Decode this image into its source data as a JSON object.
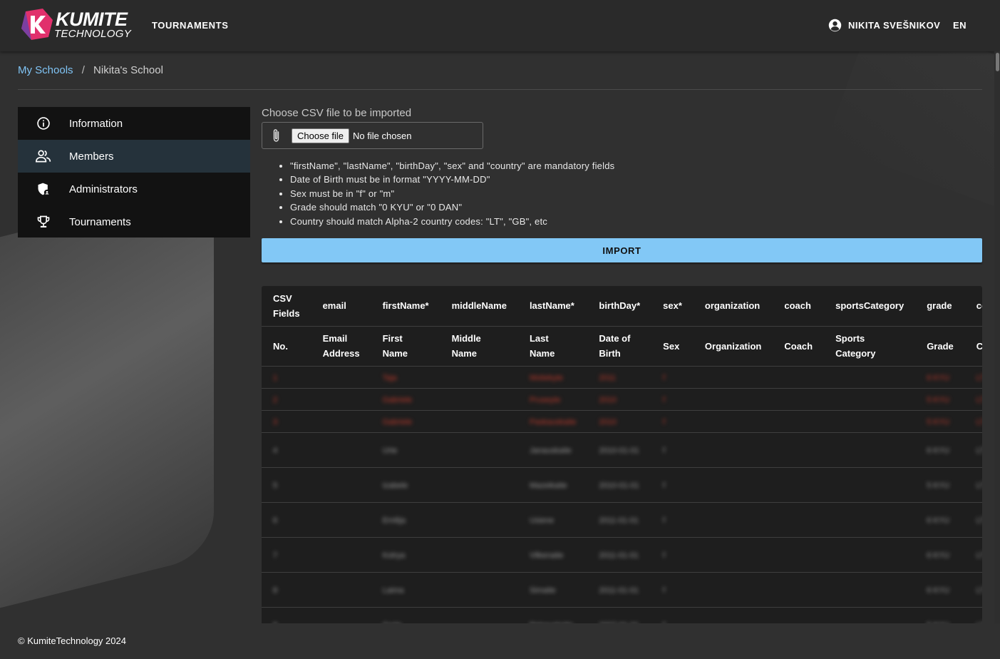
{
  "brand": {
    "line1": "KUMITE",
    "line2": "TECHNOLOGY",
    "colors": {
      "pink": "#e1306c",
      "purple": "#7b3fa0",
      "white": "#ffffff"
    }
  },
  "header": {
    "nav_tournaments": "TOURNAMENTS",
    "user_name": "NIKITA SVEŠNIKOV",
    "language": "EN"
  },
  "breadcrumb": {
    "link": "My Schools",
    "separator": "/",
    "current": "Nikita's School"
  },
  "sidebar": {
    "items": [
      {
        "label": "Information",
        "icon": "info-icon",
        "active": false
      },
      {
        "label": "Members",
        "icon": "people-icon",
        "active": true
      },
      {
        "label": "Administrators",
        "icon": "admin-shield-icon",
        "active": false
      },
      {
        "label": "Tournaments",
        "icon": "trophy-icon",
        "active": false
      }
    ]
  },
  "import": {
    "label": "Choose CSV file to be imported",
    "choose_button": "Choose file",
    "file_status": "No file chosen",
    "rules": [
      "\"firstName\", \"lastName\", \"birthDay\", \"sex\" and \"country\" are mandatory fields",
      "Date of Birth must be in format \"YYYY-MM-DD\"",
      "Sex must be in \"f\" or \"m\"",
      "Grade should match \"0 KYU\" or \"0 DAN\"",
      "Country should match Alpha-2 country codes: \"LT\", \"GB\", etc"
    ],
    "button": "IMPORT",
    "accent_color": "#82c8f6"
  },
  "table": {
    "csv_fields": [
      "CSV Fields",
      "email",
      "firstName*",
      "middleName",
      "lastName*",
      "birthDay*",
      "sex*",
      "organization",
      "coach",
      "sportsCategory",
      "grade",
      "country*"
    ],
    "labels": [
      "No.",
      "Email Address",
      "First Name",
      "Middle Name",
      "Last Name",
      "Date of Birth",
      "Sex",
      "Organization",
      "Coach",
      "Sports Category",
      "Grade",
      "Country"
    ],
    "error_color": "#c0392b",
    "rows": [
      {
        "status": "error",
        "cells": [
          "1",
          "",
          "Taja",
          "",
          "Motiekyte",
          "2011",
          "f",
          "",
          "",
          "",
          "6 KYU",
          "LT"
        ]
      },
      {
        "status": "error",
        "cells": [
          "2",
          "",
          "Gabriele",
          "",
          "Pruseyte",
          "2010",
          "f",
          "",
          "",
          "",
          "5 KYU",
          "LT"
        ]
      },
      {
        "status": "error",
        "cells": [
          "3",
          "",
          "Gabriele",
          "",
          "Paskauskaite",
          "2010",
          "f",
          "",
          "",
          "",
          "5 KYU",
          "LT"
        ]
      },
      {
        "status": "ok",
        "cells": [
          "4",
          "",
          "Urte",
          "",
          "Janauskaite",
          "2010-01-01",
          "f",
          "",
          "",
          "",
          "6 KYU",
          "LT"
        ]
      },
      {
        "status": "ok",
        "cells": [
          "5",
          "",
          "Izabele",
          "",
          "Mazeikaite",
          "2010-01-01",
          "f",
          "",
          "",
          "",
          "5 KYU",
          "LT"
        ]
      },
      {
        "status": "ok",
        "cells": [
          "6",
          "",
          "Emilija",
          "",
          "Usiene",
          "2011-01-01",
          "f",
          "",
          "",
          "",
          "6 KYU",
          "LT"
        ]
      },
      {
        "status": "ok",
        "cells": [
          "7",
          "",
          "Kotrya",
          "",
          "Vilkenaite",
          "2011-01-01",
          "f",
          "",
          "",
          "",
          "6 KYU",
          "LT"
        ]
      },
      {
        "status": "ok",
        "cells": [
          "8",
          "",
          "Laima",
          "",
          "Simaite",
          "2011-01-01",
          "f",
          "",
          "",
          "",
          "6 KYU",
          "LT"
        ]
      },
      {
        "status": "ok",
        "cells": [
          "9",
          "",
          "Goda",
          "",
          "Petrauskaite",
          "2007-01-01",
          "f",
          "",
          "",
          "",
          "5 KYU",
          "LT"
        ]
      }
    ]
  },
  "footer": {
    "text": "© KumiteTechnology 2024"
  }
}
